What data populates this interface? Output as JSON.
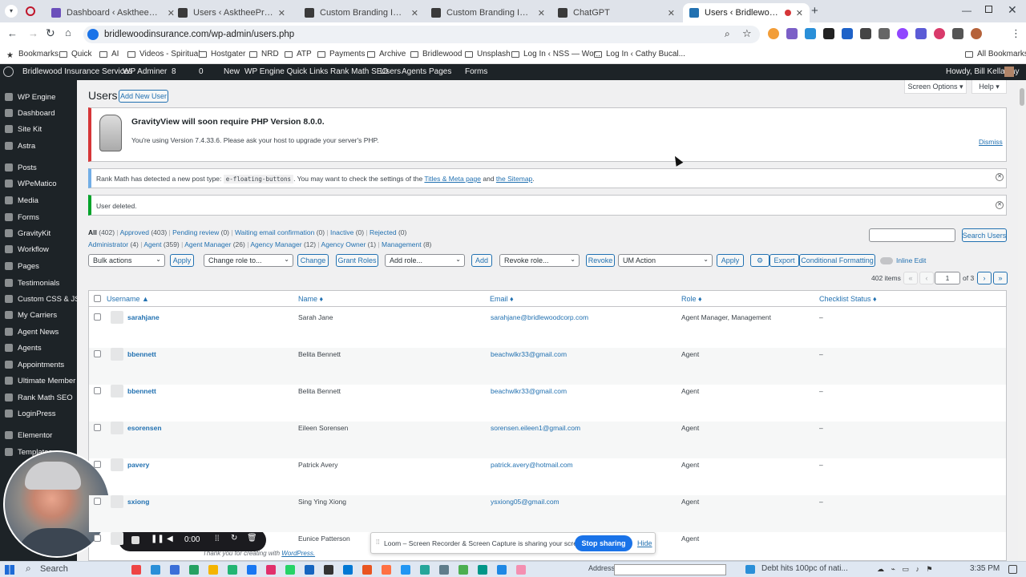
{
  "browser": {
    "tabs": [
      {
        "title": "Dashboard ‹ AsktheePros.com —",
        "color": "#6b4fbb"
      },
      {
        "title": "Users ‹ AsktheePros.com — Wo",
        "color": "#3a3a3a"
      },
      {
        "title": "Custom Branding Image Builde",
        "color": "#3a3a3a"
      },
      {
        "title": "Custom Branding Image Appro",
        "color": "#3a3a3a"
      },
      {
        "title": "ChatGPT",
        "color": "#3a3a3a"
      },
      {
        "title": "Users ‹ Bridlewood Insuran",
        "color": "#2271b1"
      }
    ],
    "url": "bridlewoodinsurance.com/wp-admin/users.php",
    "bookmarks": [
      "Bookmarks",
      "Quick",
      "AI",
      "Videos - Spiritual",
      "Hostgater",
      "NRD",
      "ATP",
      "Payments",
      "Archive",
      "Bridlewood",
      "Unsplash",
      "Log In ‹ NSS — Wor...",
      "Log In ‹ Cathy Bucal..."
    ],
    "all_bookmarks": "All Bookmarks"
  },
  "adminbar": {
    "items": [
      "Bridlewood Insurance Services",
      "WP Adminer",
      "8",
      "0",
      "New",
      "WP Engine Quick Links",
      "Rank Math SEO",
      "Users",
      "Agents",
      "Pages",
      "Forms"
    ],
    "howdy": "Howdy, Bill Kellaway"
  },
  "sidebar": [
    "WP Engine",
    "Dashboard",
    "Site Kit",
    "Astra",
    "Posts",
    "WPeMatico",
    "Media",
    "Forms",
    "GravityKit",
    "Workflow",
    "Pages",
    "Testimonials",
    "Custom CSS & JS",
    "My Carriers",
    "Agent News",
    "Agents",
    "Appointments",
    "Ultimate Member",
    "Rank Math SEO",
    "LoginPress",
    "Elementor",
    "Templates"
  ],
  "page": {
    "title": "Users",
    "add_new": "Add New User",
    "screen_options": "Screen Options ▾",
    "help": "Help ▾"
  },
  "notices": {
    "gv_title": "GravityView will soon require PHP Version 8.0.0.",
    "gv_text": "You're using Version 7.4.33.6. Please ask your host to upgrade your server's PHP.",
    "dismiss": "Dismiss",
    "rm_text_1": "Rank Math has detected a new post type:",
    "rm_code": "e-floating-buttons",
    "rm_text_2": ". You may want to check the settings of the",
    "rm_link1": "Titles & Meta page",
    "rm_and": "and",
    "rm_link2": "the Sitemap",
    "rm_end": ".",
    "deleted": "User deleted."
  },
  "filters": {
    "row1": [
      [
        "All",
        "(402)"
      ],
      [
        "Approved",
        "(403)"
      ],
      [
        "Pending review",
        "(0)"
      ],
      [
        "Waiting email confirmation",
        "(0)"
      ],
      [
        "Inactive",
        "(0)"
      ],
      [
        "Rejected",
        "(0)"
      ]
    ],
    "row2": [
      [
        "Administrator",
        "(4)"
      ],
      [
        "Agent",
        "(359)"
      ],
      [
        "Agent Manager",
        "(26)"
      ],
      [
        "Agency Manager",
        "(12)"
      ],
      [
        "Agency Owner",
        "(1)"
      ],
      [
        "Management",
        "(8)"
      ]
    ]
  },
  "search_button": "Search Users",
  "toolbar": {
    "bulk": "Bulk actions",
    "apply": "Apply",
    "change_role": "Change role to...",
    "change": "Change",
    "grant": "Grant Roles",
    "add_role": "Add role...",
    "add": "Add",
    "revoke_role": "Revoke role...",
    "revoke": "Revoke",
    "um_action": "UM Action",
    "apply2": "Apply",
    "export": "Export",
    "conditional": "Conditional Formatting",
    "inline_edit": "Inline Edit"
  },
  "pagination": {
    "items": "402 items",
    "first": "«",
    "prev": "‹",
    "page": "1",
    "of": "of 3",
    "next": "›",
    "last": "»"
  },
  "table": {
    "headers": [
      "Username ▲",
      "Name ♦",
      "Email ♦",
      "Role ♦",
      "Checklist Status ♦"
    ],
    "rows": [
      [
        "sarahjane",
        "Sarah Jane",
        "sarahjane@bridlewoodcorp.com",
        "Agent Manager, Management",
        "–"
      ],
      [
        "bbennett",
        "Belita Bennett",
        "beachwlkr33@gmail.com",
        "Agent",
        "–"
      ],
      [
        "bbennett",
        "Belita Bennett",
        "beachwlkr33@gmail.com",
        "Agent",
        "–"
      ],
      [
        "esorensen",
        "Eileen Sorensen",
        "sorensen.eileen1@gmail.com",
        "Agent",
        "–"
      ],
      [
        "pavery",
        "Patrick Avery",
        "patrick.avery@hotmail.com",
        "Agent",
        "–"
      ],
      [
        "sxiong",
        "Sing Ying Xiong",
        "ysxiong05@gmail.com",
        "Agent",
        "–"
      ],
      [
        "",
        "Eunice Patterson",
        "",
        "Agent",
        ""
      ]
    ]
  },
  "footer_text": "Thank you for creating with",
  "footer_link": "WordPress.",
  "loom": {
    "time": "0:00",
    "bar": "Loom – Screen Recorder & Screen Capture is sharing your screen.",
    "stop": "Stop sharing",
    "hide": "Hide"
  },
  "taskbar": {
    "search": "Search",
    "address": "Address",
    "news": "Debt hits 100pc of nati...",
    "time": "3:35 PM"
  }
}
